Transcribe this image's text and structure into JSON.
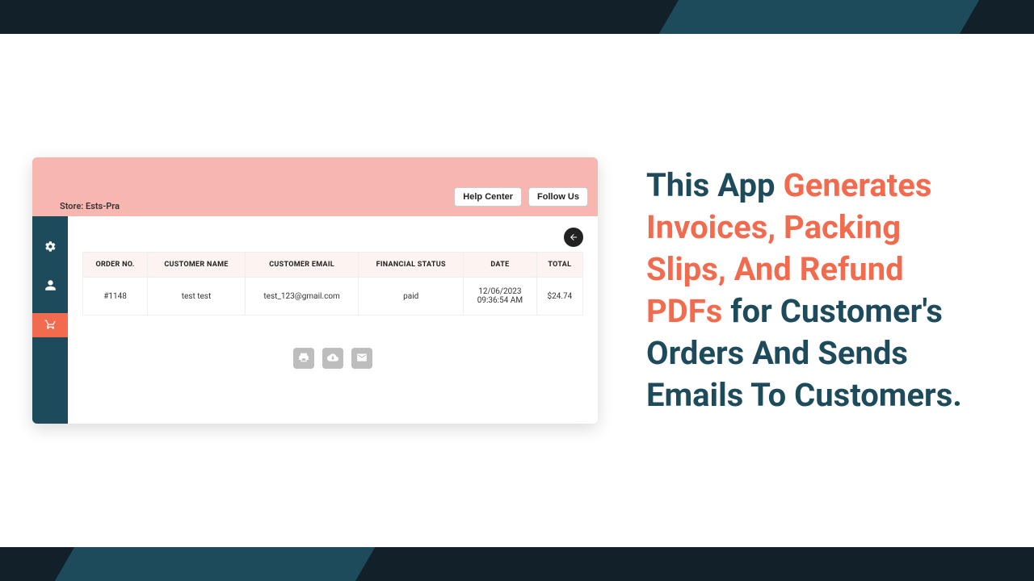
{
  "header": {
    "store_label": "Store: Ests-Pra",
    "help_center": "Help Center",
    "follow_us": "Follow Us"
  },
  "table": {
    "columns": [
      "ORDER NO.",
      "CUSTOMER NAME",
      "CUSTOMER EMAIL",
      "FINANCIAL STATUS",
      "DATE",
      "TOTAL"
    ],
    "row": {
      "order_no": "#1148",
      "customer_name": "test test",
      "customer_email": "test_123@gmail.com",
      "financial_status": "paid",
      "date_line1": "12/06/2023",
      "date_line2": "09:36:54 AM",
      "total": "$24.74"
    }
  },
  "marketing": {
    "p1": "This App ",
    "accent": "Generates Invoices, Packing Slips, And Refund PDFs ",
    "p2": "for Customer's Orders And Sends Emails To Customers."
  }
}
